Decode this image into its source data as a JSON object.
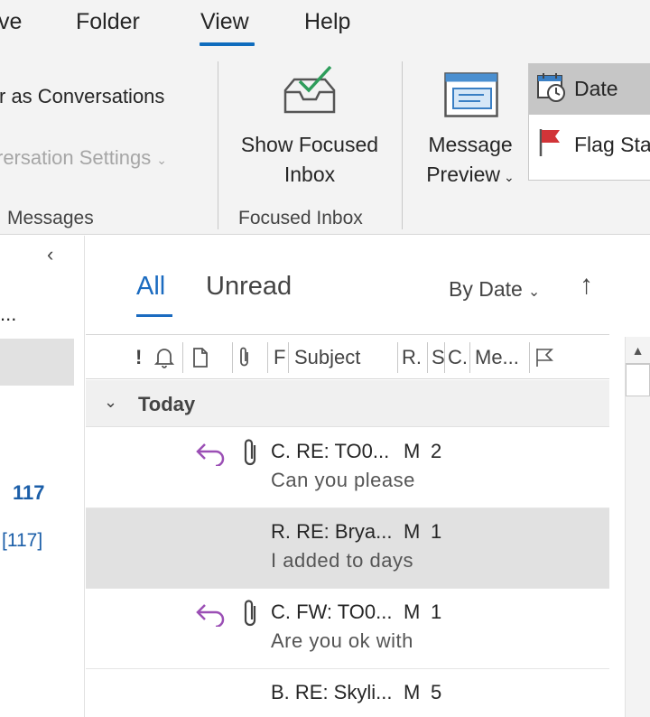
{
  "menu": {
    "tabs": [
      {
        "label": "ve"
      },
      {
        "label": "Folder"
      },
      {
        "label": "View"
      },
      {
        "label": "Help"
      }
    ],
    "active_tab": "View"
  },
  "ribbon": {
    "messages_group": {
      "show_as_conversations": "r as Conversations",
      "conversation_settings": "rersation Settings",
      "label": "Messages"
    },
    "focused_group": {
      "button_line1": "Show Focused",
      "button_line2": "Inbox",
      "label": "Focused Inbox"
    },
    "preview": {
      "line1": "Message",
      "line2": "Preview"
    },
    "arrangement": {
      "date": "Date",
      "flag": "Flag Sta"
    }
  },
  "folder_pane": {
    "truncated": "...",
    "unread_count": "117",
    "unread_count_bracketed": "[117]"
  },
  "list": {
    "filters": {
      "all": "All",
      "unread": "Unread"
    },
    "sort_label": "By Date",
    "columns": {
      "importance": "!",
      "flag": "F",
      "subject": "Subject",
      "received": "R.",
      "size": "S",
      "categories": "C.",
      "mention": "Me..."
    },
    "group_label": "Today",
    "messages": [
      {
        "line1": "C. RE: TO0...",
        "size": "M",
        "count": "2",
        "preview": "Can you please",
        "replied": true,
        "attachment": true
      },
      {
        "line1": "R. RE: Brya...",
        "size": "M",
        "count": "1",
        "preview": "I added to days",
        "replied": false,
        "attachment": false
      },
      {
        "line1": "C. FW: TO0...",
        "size": "M",
        "count": "1",
        "preview": "Are you ok with",
        "replied": true,
        "attachment": true
      },
      {
        "line1": "B. RE: Skyli...",
        "size": "M",
        "count": "5",
        "preview": "",
        "replied": false,
        "attachment": false
      }
    ]
  },
  "colors": {
    "accent": "#0f6cbd",
    "link": "#1b6bc0",
    "reply_icon": "#9b4fb5",
    "ribbon_bg": "#f3f3f3"
  }
}
